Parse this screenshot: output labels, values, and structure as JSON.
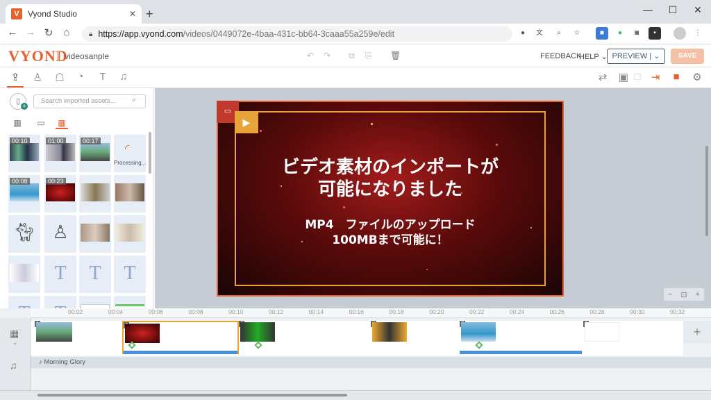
{
  "browser": {
    "tab_title": "Vyond Studio",
    "favicon": "V",
    "url_base": "https://app.vyond.com",
    "url_path": "/videos/0449072e-4baa-431c-bb64-3caaa55a259e/edit"
  },
  "app": {
    "logo": "VYOND",
    "video_name": "videosanple",
    "feedback": "FEEDBACK",
    "help": "HELP ⌄",
    "preview": "PREVIEW  |  ⌄",
    "save": "SAVE",
    "accent": "#e8602c"
  },
  "assets": {
    "search_placeholder": "Search imported assets...",
    "durations": [
      "00:10",
      "01:00",
      "00:17",
      "00:08",
      "00:23"
    ],
    "processing": "Processing..."
  },
  "canvas": {
    "title_line1": "ビデオ素材のインポートが",
    "title_line2": "可能になりました",
    "sub_line1": "MP4　ファイルのアップロード",
    "sub_line2": "100MBまで可能に！"
  },
  "timeline": {
    "ticks": [
      "00:02",
      "00:04",
      "00:06",
      "00:08",
      "00:10",
      "00:12",
      "00:14",
      "00:16",
      "00:18",
      "00:20",
      "00:22",
      "00:24",
      "00:26",
      "00:28",
      "00:30",
      "00:32"
    ],
    "scene_numbers": [
      "1",
      "2",
      "3",
      "4",
      "5",
      "6"
    ],
    "audio_track": "Morning Glory"
  }
}
